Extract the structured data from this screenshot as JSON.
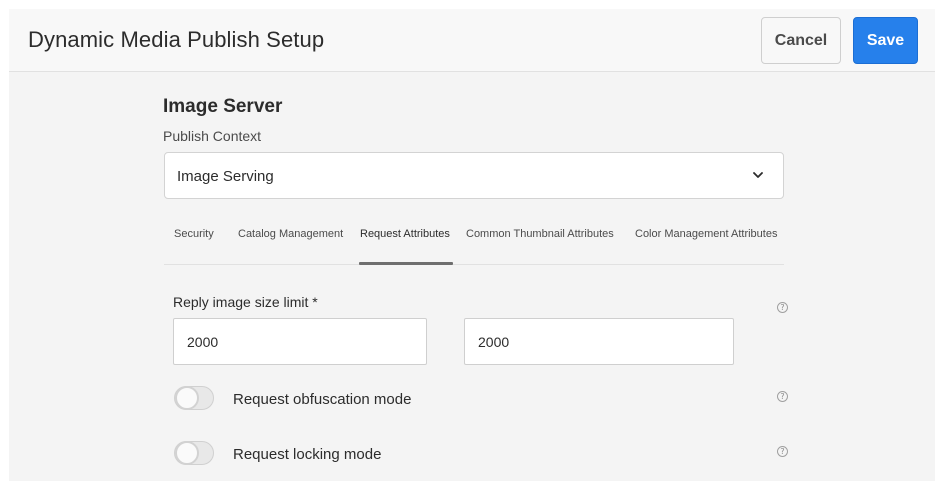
{
  "header": {
    "title": "Dynamic Media Publish Setup",
    "cancel_label": "Cancel",
    "save_label": "Save",
    "save_color": "#2680eb"
  },
  "main": {
    "section_title": "Image Server",
    "publish_context": {
      "label": "Publish Context",
      "selected_value": "Image Serving",
      "icon": "chevron-down-icon"
    },
    "tabs": [
      {
        "label": "Security",
        "active": false
      },
      {
        "label": "Catalog Management",
        "active": false
      },
      {
        "label": "Request Attributes",
        "active": true
      },
      {
        "label": "Common Thumbnail Attributes",
        "active": false
      },
      {
        "label": "Color Management Attributes",
        "active": false
      }
    ],
    "reply_size": {
      "label": "Reply image size limit *",
      "width_value": "2000",
      "height_value": "2000",
      "help_icon": "help-icon",
      "help_glyph": "?"
    },
    "toggles": [
      {
        "label": "Request obfuscation mode",
        "on": false,
        "help_glyph": "?"
      },
      {
        "label": "Request locking mode",
        "on": false,
        "help_glyph": "?"
      }
    ]
  }
}
